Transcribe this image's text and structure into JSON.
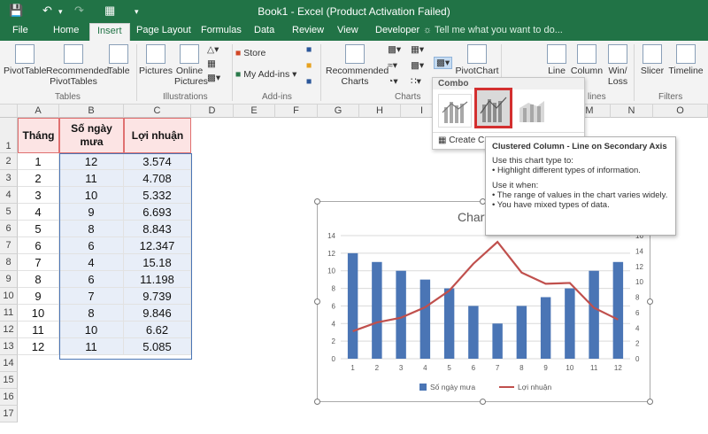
{
  "window": {
    "title": "Book1 - Excel (Product Activation Failed)"
  },
  "tabs": [
    "File",
    "Home",
    "Insert",
    "Page Layout",
    "Formulas",
    "Data",
    "Review",
    "View",
    "Developer"
  ],
  "active_tab": "Insert",
  "tell_me": "Tell me what you want to do...",
  "ribbon": {
    "pivottable": "PivotTable",
    "recommended_pivottables": [
      "Recommended",
      "PivotTables"
    ],
    "table": "Table",
    "group_tables": "Tables",
    "pictures": "Pictures",
    "online_pictures": [
      "Online",
      "Pictures"
    ],
    "group_illustrations": "Illustrations",
    "store": "Store",
    "my_addins": "My Add-ins",
    "group_addins": "Add-ins",
    "recommended_charts": [
      "Recommended",
      "Charts"
    ],
    "group_charts": "Charts",
    "pivotchart": "PivotChart",
    "line": "Line",
    "column": "Column",
    "winloss": [
      "Win/",
      "Loss"
    ],
    "group_sparklines": "lines",
    "slicer": "Slicer",
    "timeline": "Timeline",
    "group_filters": "Filters"
  },
  "columns": [
    "A",
    "B",
    "C",
    "D",
    "E",
    "F",
    "G",
    "H",
    "I",
    "J",
    "K",
    "L",
    "M",
    "N",
    "O"
  ],
  "rows": [
    "1",
    "2",
    "3",
    "4",
    "5",
    "6",
    "7",
    "8",
    "9",
    "10",
    "11",
    "12",
    "13",
    "14",
    "15",
    "16",
    "17"
  ],
  "table": {
    "headers": [
      "Tháng",
      "Số ngày mưa",
      "Lợi nhuận"
    ],
    "months": [
      "1",
      "2",
      "3",
      "4",
      "5",
      "6",
      "7",
      "8",
      "9",
      "10",
      "11",
      "12"
    ],
    "rain_days": [
      "12",
      "11",
      "10",
      "9",
      "8",
      "6",
      "4",
      "6",
      "7",
      "8",
      "10",
      "11"
    ],
    "profit": [
      "3.574",
      "4.708",
      "5.332",
      "6.693",
      "8.843",
      "12.347",
      "15.18",
      "11.198",
      "9.739",
      "9.846",
      "6.62",
      "5.085"
    ]
  },
  "combo_menu": {
    "title": "Combo",
    "create": "Create C"
  },
  "tooltip": {
    "title": "Clustered Column - Line on Secondary Axis",
    "use_label": "Use this chart type to:",
    "use_item": "• Highlight different types of information.",
    "when_label": "Use it when:",
    "when_item1": "• The range of values in the chart varies widely.",
    "when_item2": "• You have mixed types of data."
  },
  "chart_data": {
    "type": "bar",
    "title": "Chart",
    "categories": [
      1,
      2,
      3,
      4,
      5,
      6,
      7,
      8,
      9,
      10,
      11,
      12
    ],
    "series": [
      {
        "name": "Số ngày mưa",
        "type": "bar",
        "axis": "primary",
        "color": "#4a75b5",
        "values": [
          12,
          11,
          10,
          9,
          8,
          6,
          4,
          6,
          7,
          8,
          10,
          11
        ]
      },
      {
        "name": "Lợi nhuận",
        "type": "line",
        "axis": "secondary",
        "color": "#c0504d",
        "values": [
          3.574,
          4.708,
          5.332,
          6.693,
          8.843,
          12.347,
          15.18,
          11.198,
          9.739,
          9.846,
          6.62,
          5.085
        ]
      }
    ],
    "ylim": [
      0,
      14
    ],
    "y2lim": [
      0,
      16
    ],
    "yticks": [
      "0",
      "2",
      "4",
      "6",
      "8",
      "10",
      "12",
      "14"
    ],
    "y2ticks": [
      "0",
      "2",
      "4",
      "6",
      "8",
      "10",
      "12",
      "14",
      "16"
    ],
    "legend": "bottom"
  },
  "colors": {
    "excel_green": "#217346",
    "accent_red": "#d32f2f"
  }
}
